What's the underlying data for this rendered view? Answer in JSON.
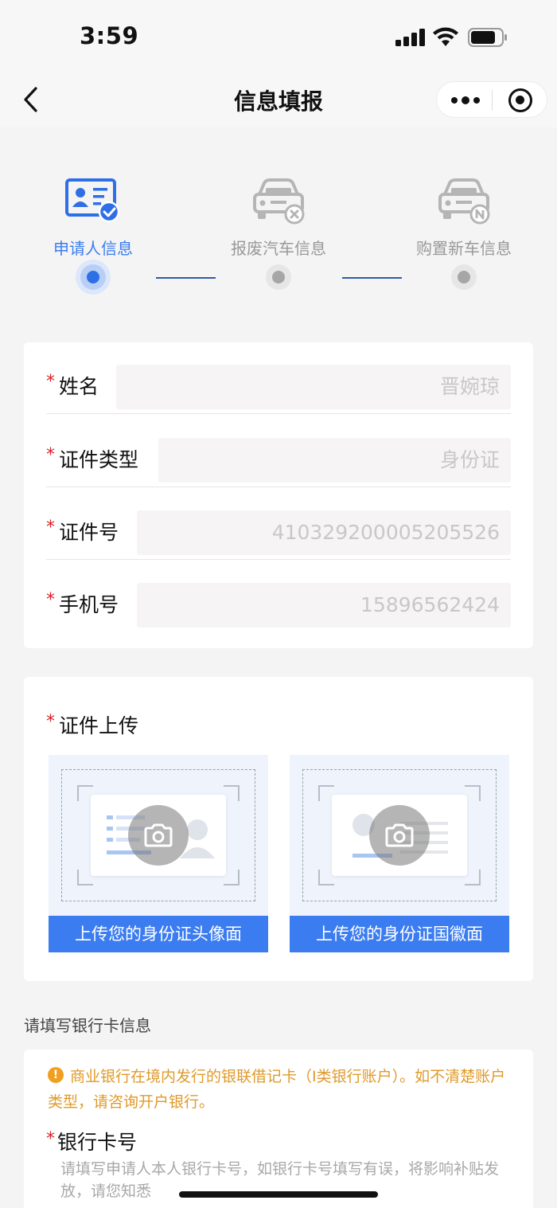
{
  "status_bar": {
    "time": "3:59"
  },
  "nav": {
    "title": "信息填报"
  },
  "steps": [
    {
      "label": "申请人信息",
      "icon": "id-card-check-icon",
      "active": true
    },
    {
      "label": "报废汽车信息",
      "icon": "car-scrap-icon",
      "active": false
    },
    {
      "label": "购置新车信息",
      "icon": "car-new-icon",
      "active": false
    }
  ],
  "form": {
    "name": {
      "label": "姓名",
      "value": "晋婉琼"
    },
    "id_type": {
      "label": "证件类型",
      "value": "身份证"
    },
    "id_number": {
      "label": "证件号",
      "value": "410329200005205526"
    },
    "phone": {
      "label": "手机号",
      "value": "15896562424"
    }
  },
  "upload": {
    "title": "证件上传",
    "front_button": "上传您的身份证头像面",
    "back_button": "上传您的身份证国徽面"
  },
  "bank": {
    "heading": "请填写银行卡信息",
    "notice": "商业银行在境内发行的银联借记卡（I类银行账户）。如不清楚账户类型，请咨询开户银行。",
    "card_label": "银行卡号",
    "card_hint": "请填写申请人本人银行卡号，如银行卡号填写有误，将影响补贴发放，请您知悉"
  },
  "colors": {
    "accent": "#3b7cf0",
    "required": "#d8232a",
    "notice": "#e09a2a"
  }
}
